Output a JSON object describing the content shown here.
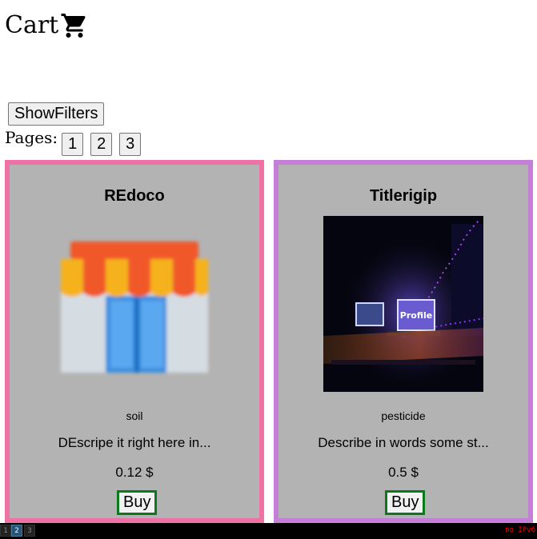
{
  "header": {
    "title": "Cart",
    "icon": "shopping-cart-icon"
  },
  "filters": {
    "button_label": "ShowFilters"
  },
  "pagination": {
    "label": "Pages:",
    "pages": [
      "1",
      "2",
      "3"
    ]
  },
  "products": [
    {
      "title": "REdoco",
      "image": "storefront-icon",
      "category": "soil",
      "description": "DEscripe it right here in...",
      "price": "0.12 $",
      "buy_label": "Buy",
      "border_color": "#ef72a6"
    },
    {
      "title": "Titlerigip",
      "image": "desk-setup-photo",
      "category": "pesticide",
      "description": "Describe in words some st...",
      "price": "0.5 $",
      "buy_label": "Buy",
      "border_color": "#c47fd6"
    }
  ],
  "taskbar": {
    "workspaces": [
      "1",
      "2",
      "3"
    ],
    "active_workspace": "2",
    "status": "no IPv6"
  },
  "colors": {
    "card_background": "#b3b3b3",
    "buy_border": "#0a7a1a"
  }
}
